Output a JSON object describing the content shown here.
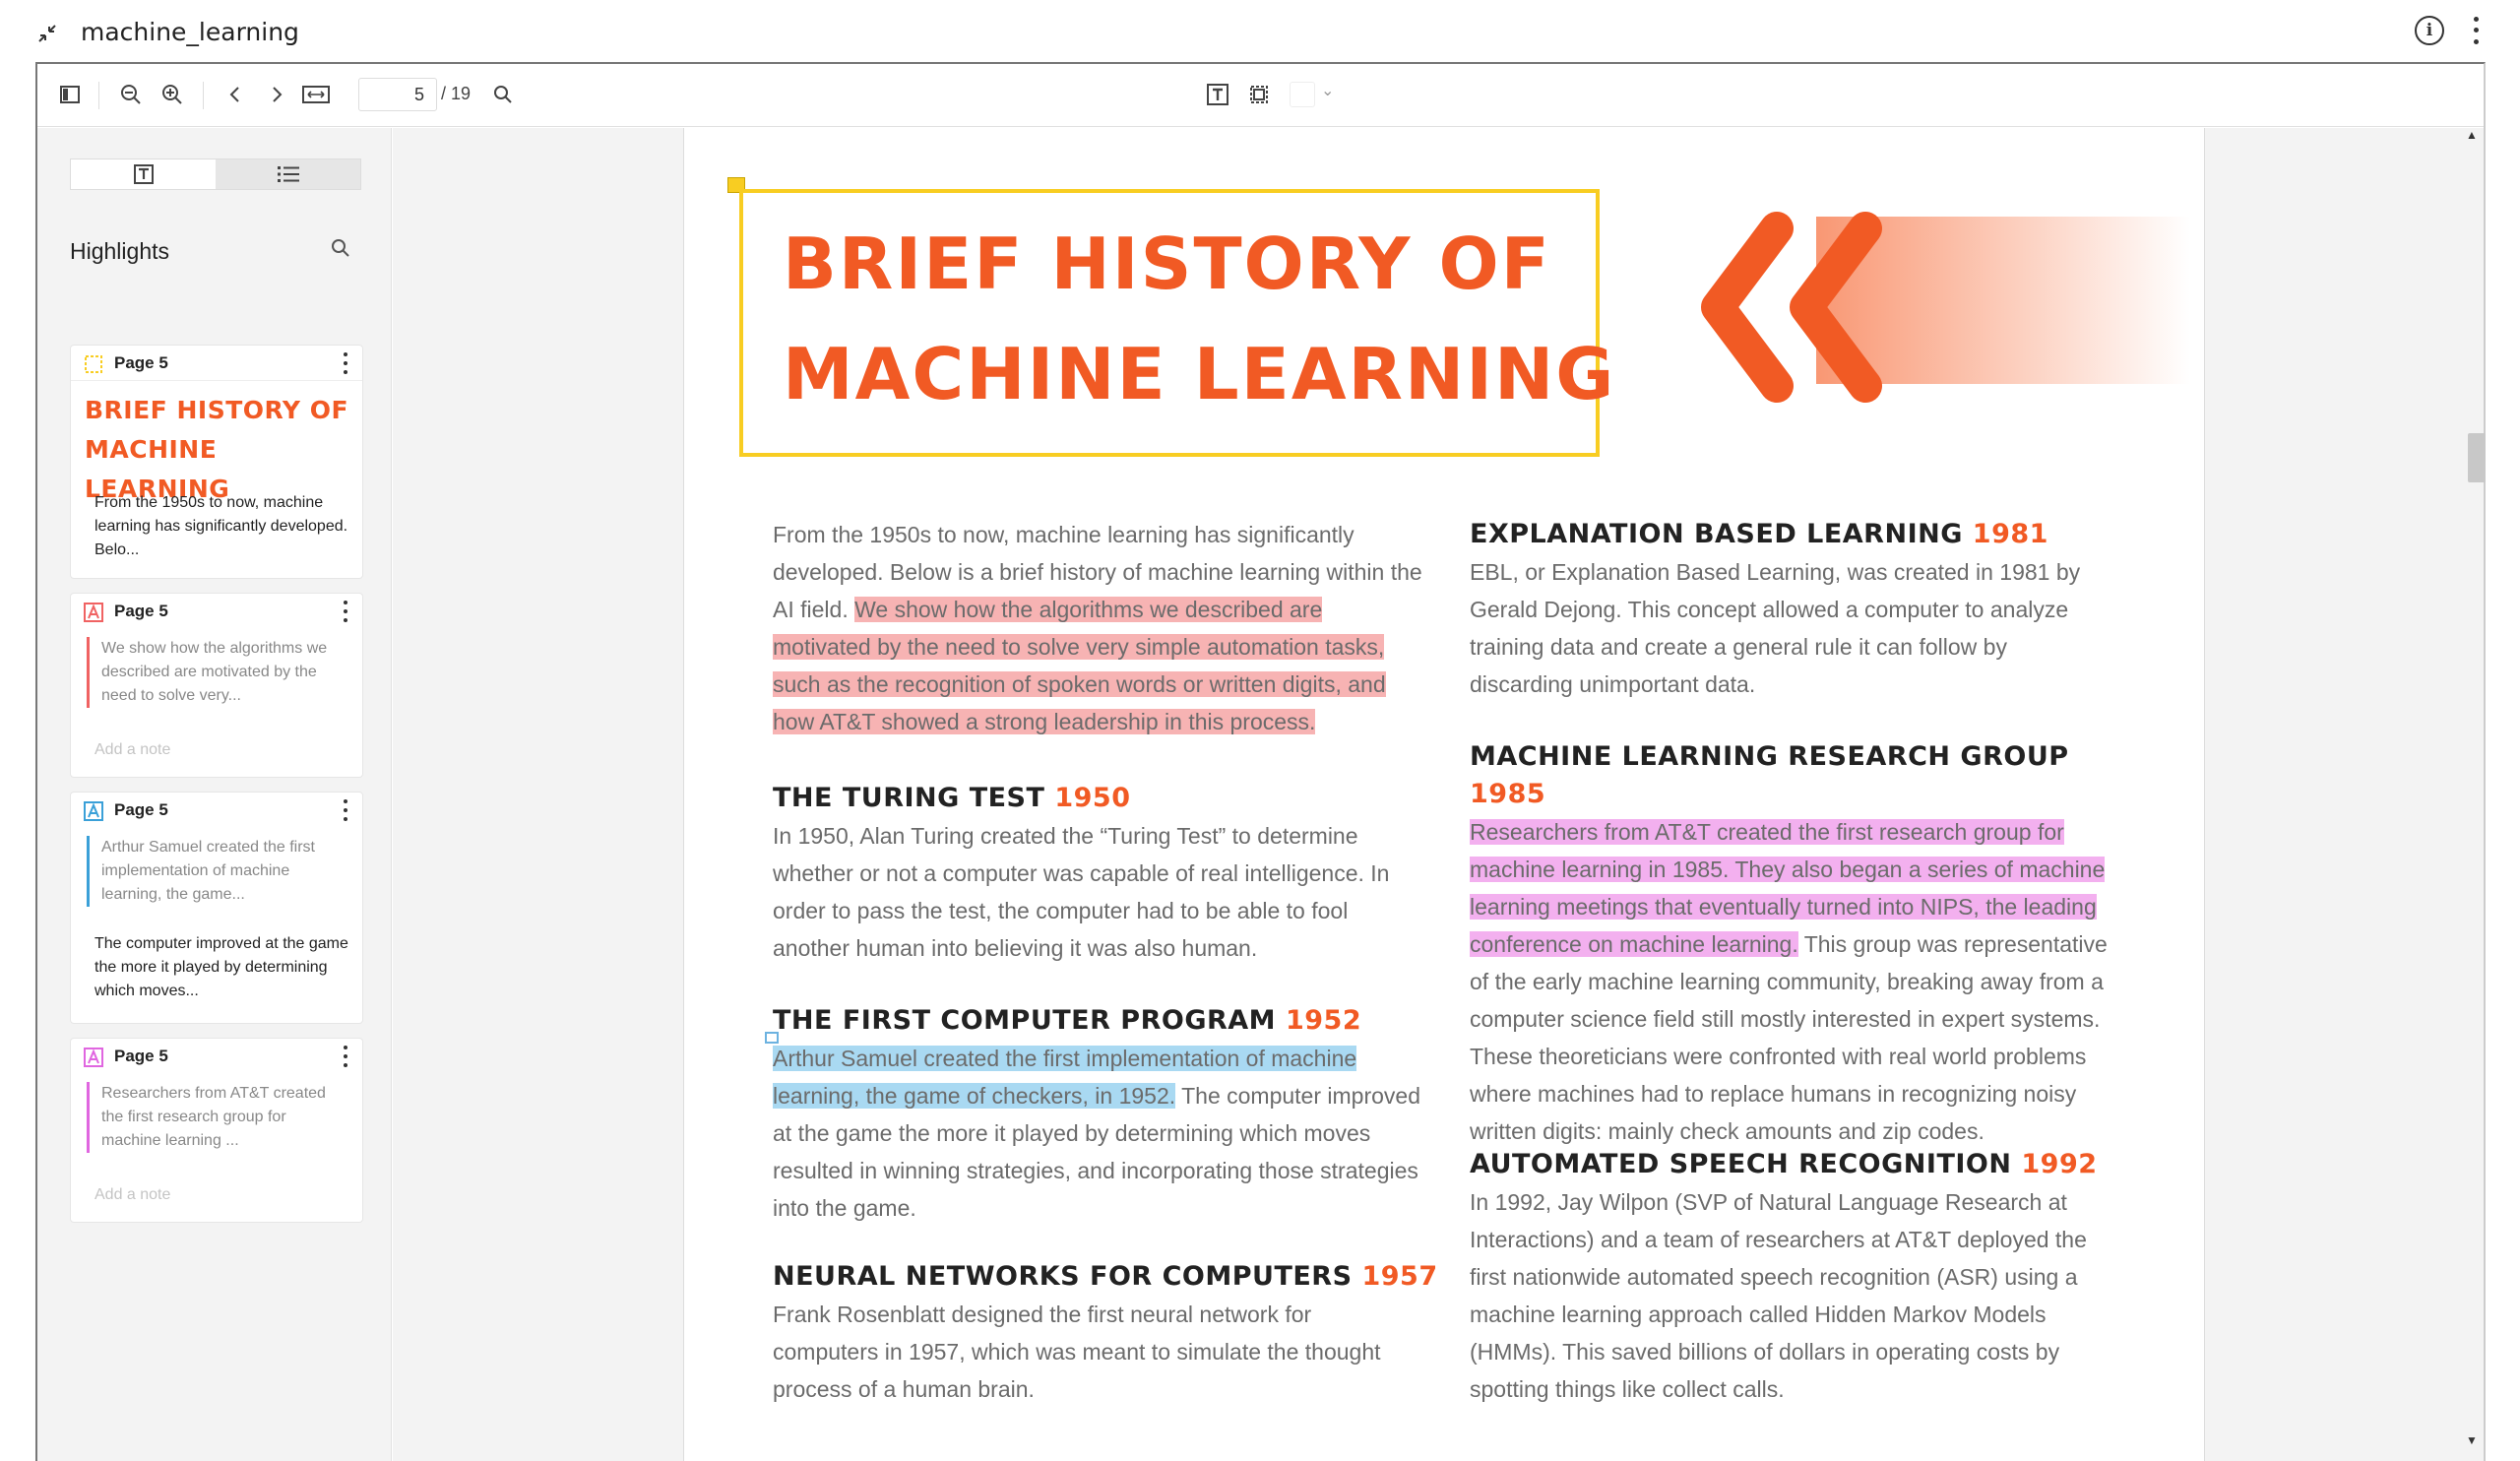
{
  "app": {
    "doc_title": "machine_learning"
  },
  "toolbar": {
    "page_current": "5",
    "page_total": "/ 19"
  },
  "sidebar": {
    "header": "Highlights",
    "cards": [
      {
        "page": "Page 5",
        "type": "area",
        "title_lines": [
          "BRIEF HISTORY OF",
          "MACHINE LEARNING"
        ],
        "note": "From the 1950s to now, machine learning has significantly developed. Belo...",
        "color": "#f8cd22"
      },
      {
        "page": "Page 5",
        "type": "text",
        "quote": "We show how the algorithms we described are motivated by the need to solve very...",
        "note": "Add a note",
        "color": "#f06262"
      },
      {
        "page": "Page 5",
        "type": "text",
        "quote": "Arthur Samuel created the first implementation of machine learning, the game...",
        "note": "The computer improved at the game the more it played by determining which moves...",
        "color": "#3aa0d8"
      },
      {
        "page": "Page 5",
        "type": "text",
        "quote": "Researchers from AT&T created the first research group for machine learning ...",
        "note": "Add a note",
        "color": "#e066e0"
      }
    ],
    "colors": [
      "#f8cd22",
      "#f06262",
      "#3aa0d8",
      "#e066e0"
    ]
  },
  "page": {
    "title_line1": "BRIEF HISTORY OF",
    "title_line2": "MACHINE LEARNING",
    "intro_plain": "From the 1950s to now, machine learning has significantly developed. Below is a brief history of machine learning within the AI field. ",
    "intro_hl": "We show how the algorithms we described are motivated by the need to solve very simple automation tasks, such as the recognition of spoken words or written digits, and how AT&T showed a strong leadership in this process.",
    "turing_title": "THE TURING TEST",
    "turing_year": "1950",
    "turing_body": "In 1950, Alan Turing created the “Turing Test” to determine whether or not a computer was capable of real intelligence. In order to pass the test, the computer had to be able to fool another human into believing it was also human.",
    "program_title": "THE FIRST COMPUTER PROGRAM",
    "program_year": "1952",
    "program_hl": "Arthur Samuel created the first implementation of machine learning, the game of checkers, in 1952.",
    "program_body": " The computer improved at the game the more it played by determining which moves resulted in winning strategies, and incorporating those strategies into the game.",
    "neural_title": "NEURAL NETWORKS FOR COMPUTERS",
    "neural_year": "1957",
    "neural_body": "Frank Rosenblatt designed the first neural network for computers in 1957, which was meant to simulate the thought process of a human brain.",
    "ebl_title": "EXPLANATION BASED LEARNING",
    "ebl_year": "1981",
    "ebl_body": "EBL, or Explanation Based Learning, was created in 1981 by Gerald Dejong. This concept allowed a computer to analyze training data and create a general rule it can follow by discarding unimportant data.",
    "mlrg_title": "MACHINE LEARNING RESEARCH GROUP",
    "mlrg_year": "1985",
    "mlrg_hl": "Researchers from AT&T created the first research group for machine learning in 1985. They also began a series of machine learning meetings that eventually turned into NIPS, the leading conference on machine learning.",
    "mlrg_body": " This group was representative of the early machine learning community, breaking away from a computer science field still mostly interested in expert systems. These theoreticians were confronted with real world problems where machines had to replace humans in recognizing noisy written digits: mainly check amounts and zip codes.",
    "asr_title": "AUTOMATED SPEECH RECOGNITION",
    "asr_year": "1992",
    "asr_body": "In 1992, Jay Wilpon (SVP of Natural Language Research at Interactions) and a team of researchers at AT&T deployed the first nationwide automated speech recognition (ASR) using a machine learning approach called Hidden Markov Models (HMMs). This saved billions of dollars in operating costs by spotting things like collect calls."
  }
}
